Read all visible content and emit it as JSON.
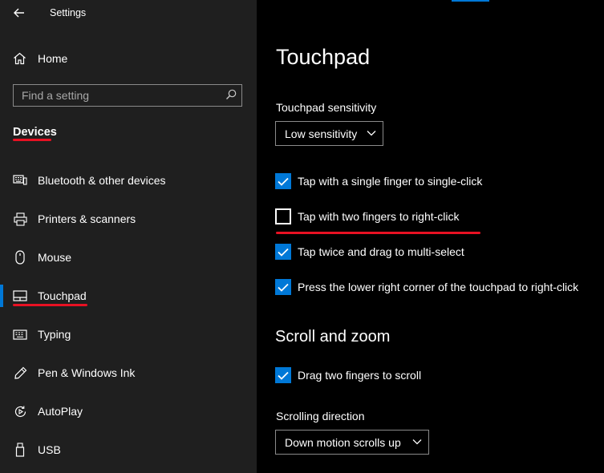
{
  "window": {
    "title": "Settings"
  },
  "sidebar": {
    "home_label": "Home",
    "search_placeholder": "Find a setting",
    "section_heading": "Devices",
    "items": [
      {
        "label": "Bluetooth & other devices",
        "icon": "bluetooth-devices-icon"
      },
      {
        "label": "Printers & scanners",
        "icon": "printer-icon"
      },
      {
        "label": "Mouse",
        "icon": "mouse-icon"
      },
      {
        "label": "Touchpad",
        "icon": "touchpad-icon",
        "selected": true
      },
      {
        "label": "Typing",
        "icon": "keyboard-icon"
      },
      {
        "label": "Pen & Windows Ink",
        "icon": "pen-icon"
      },
      {
        "label": "AutoPlay",
        "icon": "autoplay-icon"
      },
      {
        "label": "USB",
        "icon": "usb-icon"
      }
    ]
  },
  "main": {
    "title": "Touchpad",
    "sensitivity": {
      "label": "Touchpad sensitivity",
      "value": "Low sensitivity"
    },
    "checkboxes": [
      {
        "label": "Tap with a single finger to single-click",
        "checked": true
      },
      {
        "label": "Tap with two fingers to right-click",
        "checked": false
      },
      {
        "label": "Tap twice and drag to multi-select",
        "checked": true
      },
      {
        "label": "Press the lower right corner of the touchpad to right-click",
        "checked": true
      }
    ],
    "scroll_zoom": {
      "heading": "Scroll and zoom",
      "drag_scroll": {
        "label": "Drag two fingers to scroll",
        "checked": true
      },
      "direction": {
        "label": "Scrolling direction",
        "value": "Down motion scrolls up"
      }
    }
  },
  "colors": {
    "accent": "#0078d7",
    "annotation": "#e81123",
    "sidebar_bg": "#1f1f1f",
    "main_bg": "#000000"
  }
}
